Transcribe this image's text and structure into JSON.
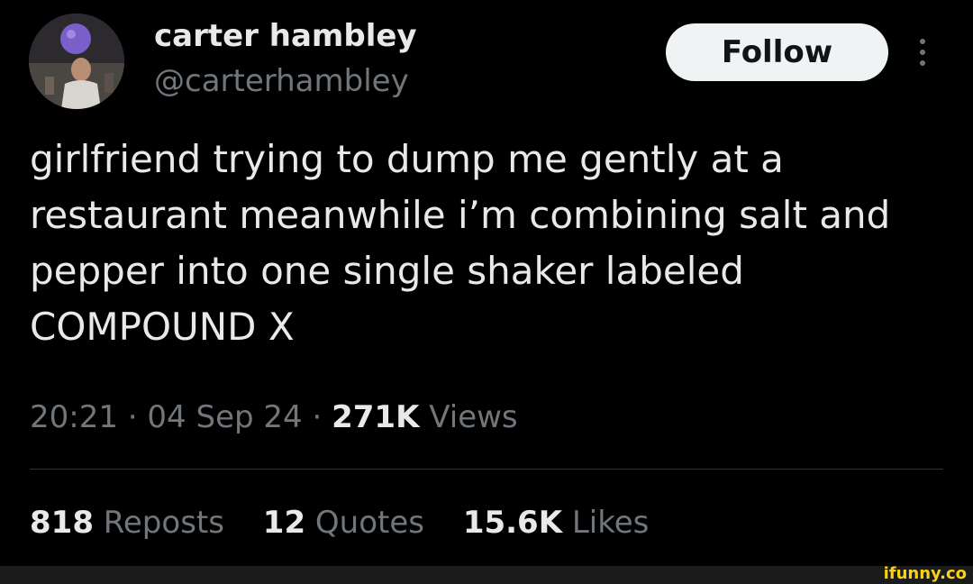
{
  "author": {
    "display_name": "carter hambley",
    "handle": "@carterhambley",
    "avatar_icon": "profile-photo"
  },
  "actions": {
    "follow_label": "Follow",
    "more_icon": "more-vertical-icon"
  },
  "tweet": {
    "text": "girlfriend trying to dump me gently at a restaurant meanwhile i’m combining salt and pepper into one single shaker labeled COMPOUND X"
  },
  "meta": {
    "time": "20:21",
    "separator": "·",
    "date": "04 Sep 24",
    "views_count": "271K",
    "views_label": "Views"
  },
  "stats": {
    "reposts_count": "818",
    "reposts_label": "Reposts",
    "quotes_count": "12",
    "quotes_label": "Quotes",
    "likes_count": "15.6K",
    "likes_label": "Likes"
  },
  "watermark": {
    "text": "ifunny.co"
  },
  "colors": {
    "background": "#000000",
    "primary_text": "#e7e9ea",
    "secondary_text": "#71767b",
    "follow_button_bg": "#eff3f4",
    "divider": "#2f3336",
    "watermark": "#f7d11a"
  }
}
